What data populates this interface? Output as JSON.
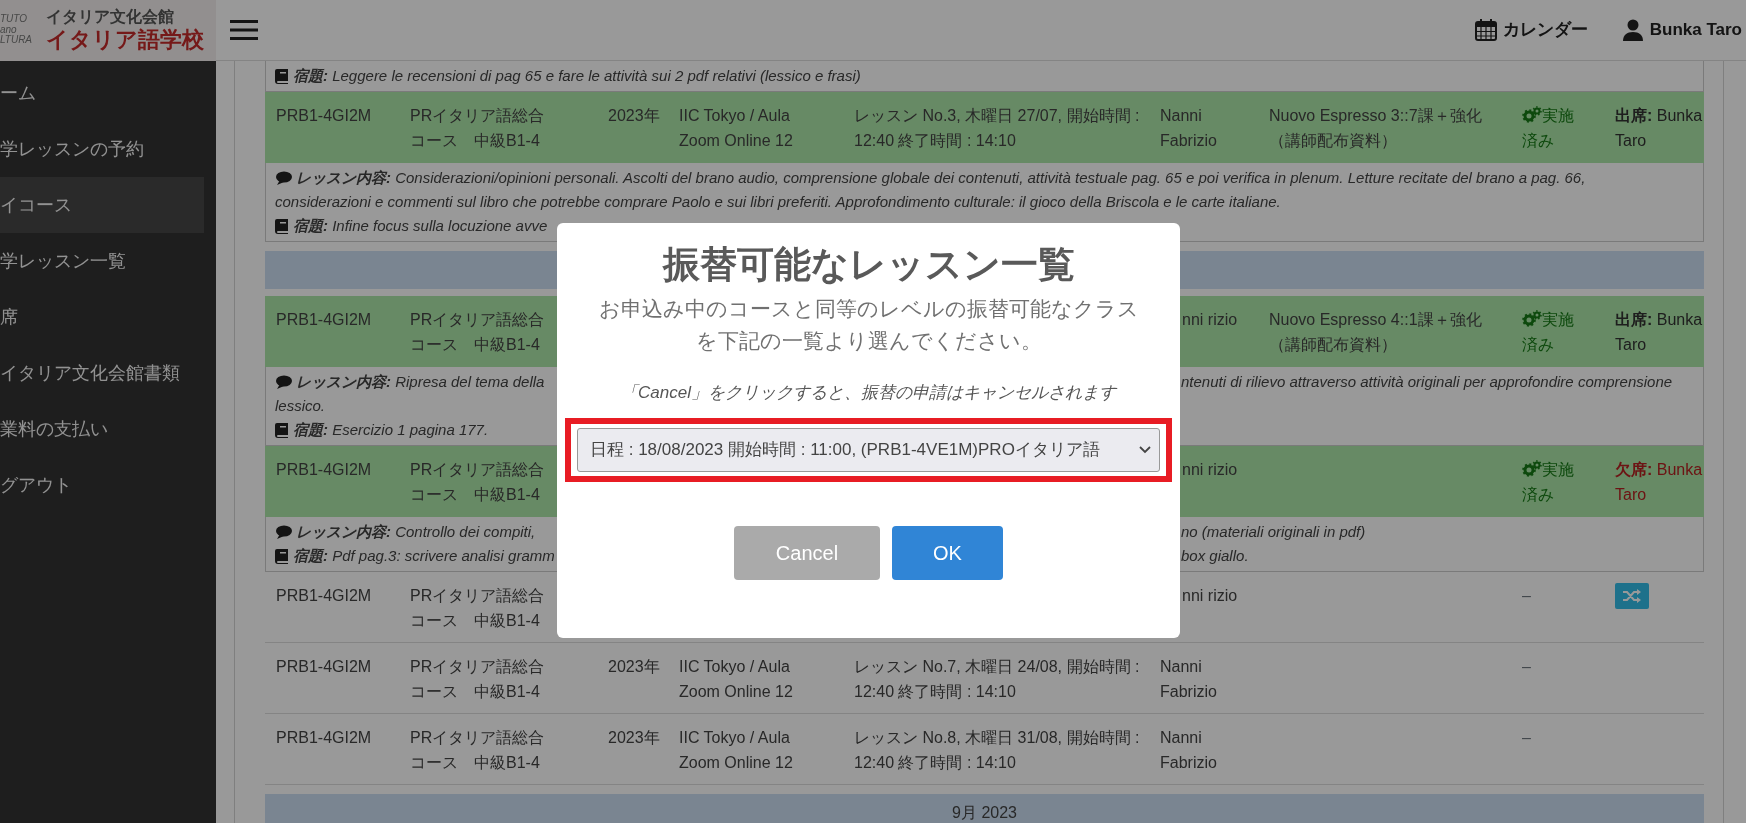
{
  "header": {
    "logo_text": [
      "TUTO",
      "ano",
      "LTURA"
    ],
    "org": "イタリア文化会館",
    "school": "イタリア語学校",
    "calendar": "カレンダー",
    "user": "Bunka Taro"
  },
  "sidebar": {
    "items": [
      {
        "label": "ーム",
        "selected": false
      },
      {
        "label": "学レッスンの予約",
        "selected": false
      },
      {
        "label": "イコース",
        "selected": true
      },
      {
        "label": "学レッスン一覧",
        "selected": false
      },
      {
        "label": "席",
        "selected": false
      },
      {
        "label": "イタリア文化会館書類",
        "selected": false
      },
      {
        "label": "業料の支払い",
        "selected": false
      },
      {
        "label": "グアウト",
        "selected": false
      }
    ]
  },
  "lessons": [
    {
      "kind": "notes",
      "lines": [
        {
          "kind": "homework",
          "text": "**宿題:** Leggere le recensioni di pag 65 e fare le attività sui 2 pdf relativi (lessico e frasi)"
        }
      ]
    },
    {
      "kind": "done_row",
      "code": "PRB1-4GI2M",
      "course": "PRイタリア語総合コース　中級B1-4",
      "year": "2023年",
      "location": "IIC Tokyo / Aula Zoom Online 12",
      "lesson": "レッスン No.3, 木曜日 27/07, 開始時間 : 12:40 終了時間 : 14:10",
      "teacher": "Nanni Fabrizio",
      "material": "Nuovo Espresso 3::7課＋強化（講師配布資料）",
      "status": {
        "kind": "done",
        "text": "実施済み"
      },
      "attendance": {
        "kind": "present",
        "label": "出席:",
        "name": "Bunka Taro"
      }
    },
    {
      "kind": "notes",
      "lines": [
        {
          "kind": "content",
          "text": "**レッスン内容:** Considerazioni/opinioni personali. Ascolti del brano audio, comprensione globale dei contenuti, attività testuale pag. 65 e poi verifica in plenum. Letture recitate del brano a pag. 66,"
        },
        {
          "kind": "continued",
          "text": "considerazioni e commenti sul libro che potrebbe comprare Paolo e sui libri preferiti. Approfondimento culturale: il gioco della Briscola e le carte italiane."
        },
        {
          "kind": "homework",
          "text": "**宿題:** Infine focus sulla locuzione avve"
        }
      ]
    },
    {
      "kind": "month"
    },
    {
      "kind": "done_row",
      "code": "PRB1-4GI2M",
      "course": "PRイタリア語総合コース　中級B1-4",
      "teacher": "nni rizio",
      "material": "Nuovo Espresso 4::1課＋強化（講師配布資料）",
      "status": {
        "kind": "done",
        "text": "実施済み"
      },
      "attendance": {
        "kind": "present",
        "label": "出席:",
        "name": "Bunka Taro"
      }
    },
    {
      "kind": "notes",
      "lines": [
        {
          "kind": "content",
          "text": "**レッスン内容:** Ripresa del tema della",
          "right": "ntenuti di rilievo attraverso attività originali per approfondire comprensione"
        },
        {
          "kind": "continued",
          "text": "lessico."
        },
        {
          "kind": "homework",
          "text": "**宿題:** Esercizio 1 pagina 177."
        }
      ]
    },
    {
      "kind": "done_row",
      "code": "PRB1-4GI2M",
      "course": "PRイタリア語総合コース　中級B1-4",
      "teacher": "nni rizio",
      "status": {
        "kind": "done",
        "text": "実施済み"
      },
      "attendance": {
        "kind": "absent",
        "label": "欠席:",
        "name": "Bunka Taro"
      }
    },
    {
      "kind": "notes",
      "lines": [
        {
          "kind": "content",
          "text": "**レッスン内容:** Controllo dei compiti,",
          "right": "no (materiali originali in pdf)"
        },
        {
          "kind": "homework",
          "text": "**宿題:** Pdf pag.3: scrivere analisi gramm",
          "right": "box giallo."
        }
      ]
    },
    {
      "kind": "plain_row",
      "code": "PRB1-4GI2M",
      "course": "PRイタリア語総合コース　中級B1-4",
      "teacher": "nni rizio",
      "status": {
        "kind": "none",
        "text": "–"
      },
      "action": {
        "kind": "shuffle"
      }
    },
    {
      "kind": "plain_row",
      "code": "PRB1-4GI2M",
      "course": "PRイタリア語総合コース　中級B1-4",
      "year": "2023年",
      "location": "IIC Tokyo / Aula Zoom Online 12",
      "lesson": "レッスン No.7, 木曜日 24/08, 開始時間 : 12:40 終了時間 : 14:10",
      "teacher": "Nanni Fabrizio",
      "status": {
        "kind": "none",
        "text": "–"
      }
    },
    {
      "kind": "plain_row",
      "code": "PRB1-4GI2M",
      "course": "PRイタリア語総合コース　中級B1-4",
      "year": "2023年",
      "location": "IIC Tokyo / Aula Zoom Online 12",
      "lesson": "レッスン No.8, 木曜日 31/08, 開始時間 : 12:40 終了時間 : 14:10",
      "teacher": "Nanni Fabrizio",
      "status": {
        "kind": "none",
        "text": "–"
      }
    },
    {
      "kind": "month",
      "label": "9月 2023"
    }
  ],
  "dialog": {
    "title": "振替可能なレッスン一覧",
    "text": "お申込み中のコースと同等のレベルの振替可能なクラスを下記の一覧より選んでください。",
    "note": "「Cancel」をクリックすると、振替の申請はキャンセルされます",
    "select": "日程 : 18/08/2023 開始時間 : 11:00, (PRB1-4VE1M)PROイタリア語",
    "highlighted": true,
    "buttons": [
      {
        "label": "Cancel",
        "kind": "cancel"
      },
      {
        "label": "OK",
        "kind": "confirm"
      }
    ]
  }
}
